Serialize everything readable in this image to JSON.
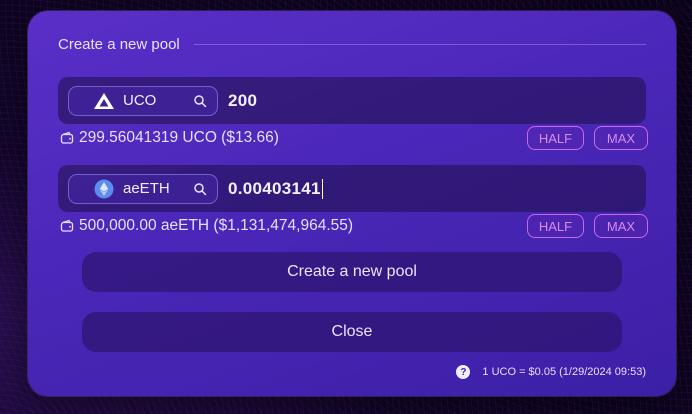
{
  "modal": {
    "title": "Create a new pool"
  },
  "token1": {
    "symbol": "UCO",
    "icon": "archethic-logo-icon",
    "amount": "200",
    "balance": "299.56041319 UCO ($13.66)",
    "half_label": "HALF",
    "max_label": "MAX"
  },
  "token2": {
    "symbol": "aeETH",
    "icon": "ethereum-logo-icon",
    "amount": "0.00403141",
    "balance": "500,000.00 aeETH ($1,131,474,964.55)",
    "half_label": "HALF",
    "max_label": "MAX"
  },
  "actions": {
    "create_label": "Create a new pool",
    "close_label": "Close"
  },
  "footer": {
    "help_glyph": "?",
    "rate_text": "1 UCO = $0.05 (1/29/2024 09:53)"
  },
  "colors": {
    "modal_bg": "#4a27b8",
    "pill_accent": "#c869e8",
    "field_bg": "#1e0f46"
  }
}
